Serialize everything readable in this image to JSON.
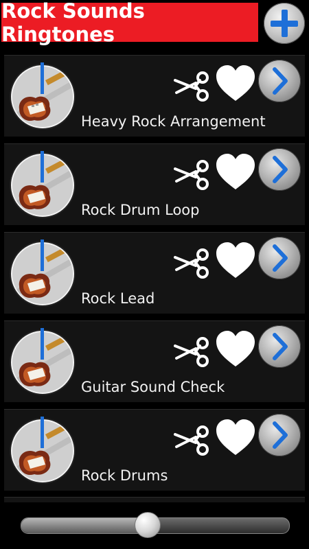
{
  "app": {
    "title": "Rock Sounds Ringtones",
    "add_icon": "plus-icon"
  },
  "ringtones": [
    {
      "label": "Heavy Rock Arrangement"
    },
    {
      "label": "Rock Drum Loop"
    },
    {
      "label": "Rock Lead"
    },
    {
      "label": "Guitar Sound Check"
    },
    {
      "label": "Rock Drums"
    }
  ],
  "row_icons": {
    "crop": "scissors-icon",
    "favorite": "heart-icon",
    "play": "chevron-right-icon",
    "thumbnail": "guitar-icon"
  },
  "player": {
    "progress": 0.47
  },
  "colors": {
    "title_bg": "#ec1c24",
    "accent_blue": "#1e6fd8",
    "background": "#000000"
  }
}
